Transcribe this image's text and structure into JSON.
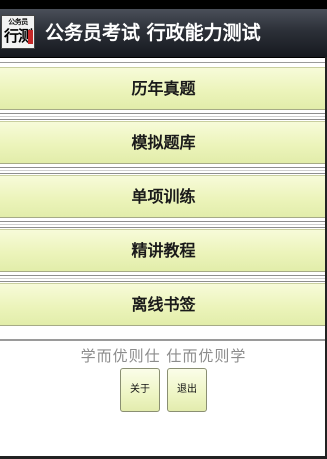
{
  "header": {
    "logo_top_text": "公务员",
    "logo_main_text": "行测",
    "title": "公务员考试 行政能力测试"
  },
  "menu": {
    "items": [
      {
        "label": "历年真题"
      },
      {
        "label": "模拟题库"
      },
      {
        "label": "单项训练"
      },
      {
        "label": "精讲教程"
      },
      {
        "label": "离线书签"
      }
    ]
  },
  "footer": {
    "slogan": "学而优则仕  仕而优则学",
    "about_label": "关于",
    "exit_label": "退出"
  },
  "colors": {
    "title_bar": "#2c3038",
    "menu_item": "#ecf4bb",
    "slogan": "#8c8c8c"
  }
}
